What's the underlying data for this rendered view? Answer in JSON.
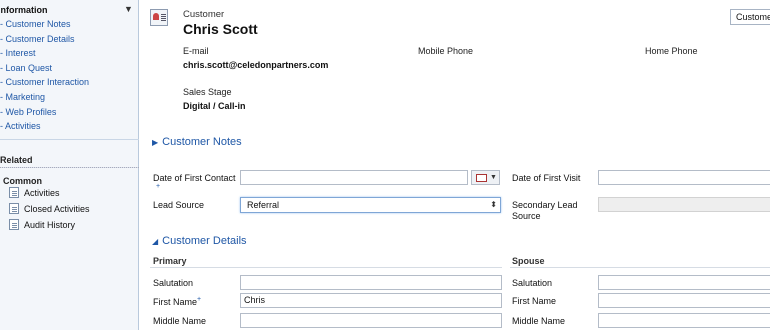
{
  "nav": {
    "header": "Information",
    "items": [
      "- Customer Notes",
      "- Customer Details",
      "- Interest",
      "- Loan Quest",
      "- Customer Interaction",
      "- Marketing",
      "- Web Profiles",
      "- Activities"
    ],
    "related_label": "Related",
    "common_label": "Common",
    "related_items": [
      "Activities",
      "Closed Activities",
      "Audit History"
    ]
  },
  "header": {
    "entity": "Customer",
    "name": "Chris Scott",
    "form_selector": "Customer",
    "email_label": "E-mail",
    "email_value": "chris.scott@celedonpartners.com",
    "mobile_label": "Mobile Phone",
    "home_label": "Home Phone",
    "stage_label": "Sales Stage",
    "stage_value": "Digital / Call-in"
  },
  "notes_section": {
    "title": "Customer Notes",
    "first_contact_label": "Date of First Contact",
    "first_visit_label": "Date of First Visit",
    "lead_source_label": "Lead Source",
    "lead_source_value": "Referral",
    "secondary_lead_label": "Secondary Lead Source"
  },
  "details_section": {
    "title": "Customer Details",
    "primary_label": "Primary",
    "spouse_label": "Spouse",
    "fields": {
      "salutation": "Salutation",
      "first_name": "First Name",
      "middle_name": "Middle Name"
    },
    "first_name_value": "Chris"
  }
}
